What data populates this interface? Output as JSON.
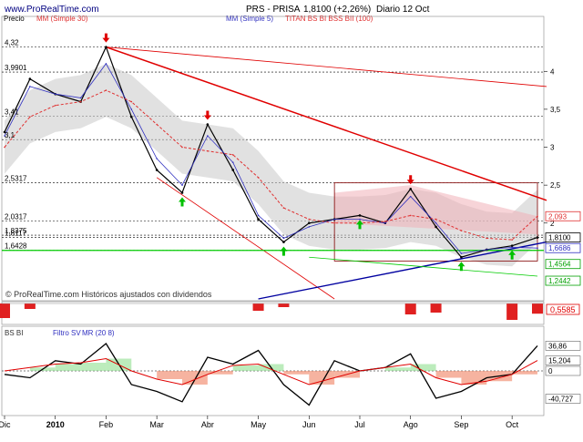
{
  "header": {
    "site": "www.ProRealTime.com",
    "ticker": "PRS - PRISA",
    "price_change": "1,8100 (+2,26%)",
    "period": "Diario 12 Oct",
    "chart_label": "Precio",
    "ma30_label": "MM (Simple 30)",
    "ma5_label": "MM (Simple 5)",
    "titan_label": "TITAN BS BI BSS BII (100)"
  },
  "footer": {
    "copyright": "© ProRealTime.com Históricos ajustados con dividendos"
  },
  "colors": {
    "price": "#000000",
    "ma30": "#e03030",
    "ma5": "#3030c0",
    "channel_red": "#e00000",
    "trend_blue": "#0000a0",
    "support_green": "#00cc00",
    "band_gray": "#c8c8c8",
    "box_dark_red": "#800000",
    "up_arrow": "#00c000",
    "down_arrow": "#e00000"
  },
  "price_axis_labels": [
    {
      "text": "4,32",
      "value": 4.32
    },
    {
      "text": "3,9901",
      "value": 3.99
    },
    {
      "text": "3,41",
      "value": 3.41
    },
    {
      "text": "3,1",
      "value": 3.1
    },
    {
      "text": "2,5317",
      "value": 2.53
    },
    {
      "text": "2,0317",
      "value": 2.03
    },
    {
      "text": "1,8375",
      "value": 1.84
    },
    {
      "text": "1,8117",
      "value": 1.81
    },
    {
      "text": "1,6428",
      "value": 1.64
    }
  ],
  "right_axis_ticks": [
    "4",
    "3,5",
    "3",
    "2,5",
    "2"
  ],
  "right_price_tags": [
    {
      "text": "2,093",
      "value": 2.09,
      "color": "#e03030"
    },
    {
      "text": "1,8100",
      "value": 1.81,
      "color": "#000000"
    },
    {
      "text": "1,6686",
      "value": 1.67,
      "color": "#3030c0"
    },
    {
      "text": "1,4564",
      "value": 1.46,
      "color": "#00a000"
    },
    {
      "text": "1,2442",
      "value": 1.24,
      "color": "#00a000"
    }
  ],
  "panel2": {
    "label": "BS BI",
    "tag": "0,5585"
  },
  "panel3": {
    "label": "BS BI",
    "filter_label": "Filtro SV",
    "mr_label": "MR (20 8)",
    "tags": [
      "36,86",
      "15,204",
      "0",
      "-40,727"
    ]
  },
  "x_axis_labels": [
    "Dic",
    "2010",
    "Feb",
    "Mar",
    "Abr",
    "May",
    "Jun",
    "Jul",
    "Ago",
    "Sep",
    "Oct"
  ],
  "chart_data": [
    {
      "type": "line",
      "title": "PRS - PRISA",
      "ylabel": "",
      "xlabel": "",
      "ylim": [
        1.0,
        4.7
      ],
      "x": [
        "Dic",
        "",
        "2010",
        "",
        "Feb",
        "",
        "Mar",
        "",
        "Abr",
        "",
        "May",
        "",
        "Jun",
        "",
        "Jul",
        "",
        "Ago",
        "",
        "Sep",
        "",
        "Oct",
        "12 Oct"
      ],
      "series": [
        {
          "name": "",
          "values": [
            3.2,
            3.9,
            3.7,
            3.6,
            4.32,
            3.4,
            2.7,
            2.4,
            3.3,
            2.7,
            2.05,
            1.75,
            2.0,
            2.05,
            2.1,
            2.0,
            2.45,
            1.95,
            1.55,
            1.65,
            1.7,
            1.81
          ]
        },
        {
          "name": "MM (Simple 5)",
          "values": [
            3.15,
            3.8,
            3.7,
            3.65,
            4.1,
            3.5,
            2.85,
            2.5,
            3.15,
            2.8,
            2.1,
            1.8,
            1.95,
            2.05,
            2.05,
            2.0,
            2.35,
            2.0,
            1.6,
            1.65,
            1.68,
            1.67
          ]
        },
        {
          "name": "MM (Simple 30)",
          "values": [
            3.0,
            3.4,
            3.55,
            3.6,
            3.75,
            3.6,
            3.3,
            3.0,
            2.95,
            2.9,
            2.6,
            2.2,
            2.05,
            2.0,
            2.0,
            2.02,
            2.1,
            2.05,
            1.9,
            1.8,
            1.78,
            2.09
          ]
        }
      ]
    },
    {
      "type": "bar",
      "title": "BS BI",
      "categories": [
        "Dic",
        "",
        "2010",
        "",
        "Feb",
        "",
        "Mar",
        "",
        "Abr",
        "",
        "May",
        "",
        "Jun",
        "",
        "Jul",
        "",
        "Ago",
        "",
        "Sep",
        "",
        "Oct",
        "12 Oct"
      ],
      "values": [
        -0.8,
        -0.3,
        0,
        0,
        0,
        0,
        0,
        0,
        0,
        0,
        -0.4,
        -0.2,
        0,
        0,
        0,
        0,
        -0.6,
        -0.5,
        0,
        0,
        -0.9,
        -0.56
      ]
    },
    {
      "type": "line",
      "title": "Filtro SV",
      "ylim": [
        -60,
        60
      ],
      "x": [
        "Dic",
        "",
        "2010",
        "",
        "Feb",
        "",
        "Mar",
        "",
        "Abr",
        "",
        "May",
        "",
        "Jun",
        "",
        "Jul",
        "",
        "Ago",
        "",
        "Sep",
        "",
        "Oct",
        "12 Oct"
      ],
      "series": [
        {
          "name": "",
          "values": [
            -5,
            -10,
            15,
            10,
            40,
            -20,
            -30,
            -45,
            20,
            10,
            30,
            -20,
            -50,
            15,
            0,
            5,
            25,
            -40,
            -30,
            -10,
            -5,
            36.86
          ]
        },
        {
          "name": "MR (20 8)",
          "values": [
            0,
            5,
            10,
            12,
            18,
            0,
            -12,
            -20,
            -5,
            8,
            10,
            -5,
            -20,
            -10,
            0,
            5,
            10,
            -10,
            -20,
            -15,
            -5,
            15.204
          ]
        }
      ]
    }
  ]
}
